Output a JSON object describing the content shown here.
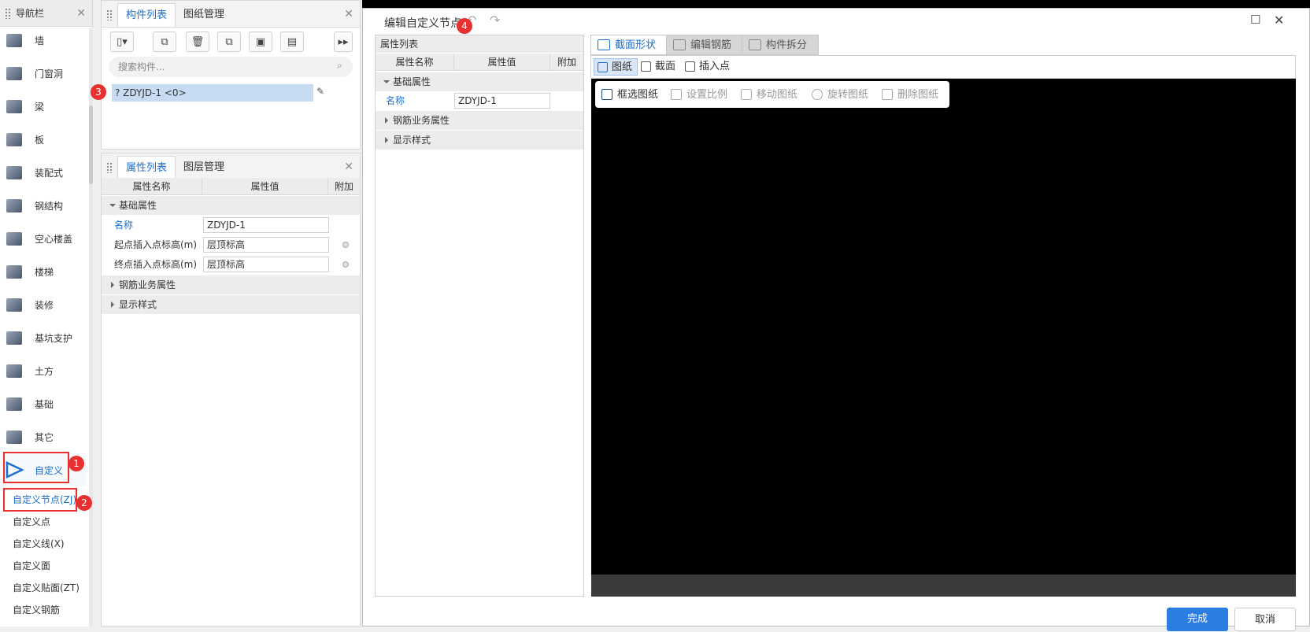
{
  "nav": {
    "title": "导航栏",
    "items": [
      "墙",
      "门窗洞",
      "梁",
      "板",
      "装配式",
      "钢结构",
      "空心楼盖",
      "楼梯",
      "装修",
      "基坑支护",
      "土方",
      "基础",
      "其它",
      "自定义"
    ],
    "subitems": [
      "自定义节点(ZJ)",
      "自定义点",
      "自定义线(X)",
      "自定义面",
      "自定义贴面(ZT)",
      "自定义钢筋"
    ]
  },
  "comp": {
    "tabs": [
      "构件列表",
      "图纸管理"
    ],
    "search_placeholder": "搜索构件...",
    "item": "? ZDYJD-1 <0>",
    "more": "▸▸"
  },
  "props": {
    "tabs": [
      "属性列表",
      "图层管理"
    ],
    "cols": [
      "属性名称",
      "属性值",
      "附加"
    ],
    "sections": [
      "基础属性",
      "钢筋业务属性",
      "显示样式"
    ],
    "rows": [
      {
        "label": "名称",
        "value": "ZDYJD-1"
      },
      {
        "label": "起点插入点标高(m)",
        "value": "层顶标高"
      },
      {
        "label": "终点插入点标高(m)",
        "value": "层顶标高"
      }
    ]
  },
  "badges": [
    "1",
    "2",
    "3",
    "4"
  ],
  "dialog": {
    "title": "编辑自定义节点",
    "undo": "↶",
    "redo": "↷",
    "max": "☐",
    "close": "✕",
    "left_title": "属性列表",
    "cols": [
      "属性名称",
      "属性值",
      "附加"
    ],
    "sections": [
      "基础属性",
      "钢筋业务属性",
      "显示样式"
    ],
    "name_label": "名称",
    "name_value": "ZDYJD-1",
    "tabs": [
      "截面形状",
      "编辑钢筋",
      "构件拆分"
    ],
    "subtabs": [
      "图纸",
      "截面",
      "插入点"
    ],
    "tools": [
      "框选图纸",
      "设置比例",
      "移动图纸",
      "旋转图纸",
      "删除图纸"
    ],
    "ok": "完成",
    "cancel": "取消"
  },
  "colors": {
    "accent": "#1a6fd1",
    "badge": "#e83030",
    "canvas": "#000000",
    "ok_button": "#2b7de1"
  }
}
